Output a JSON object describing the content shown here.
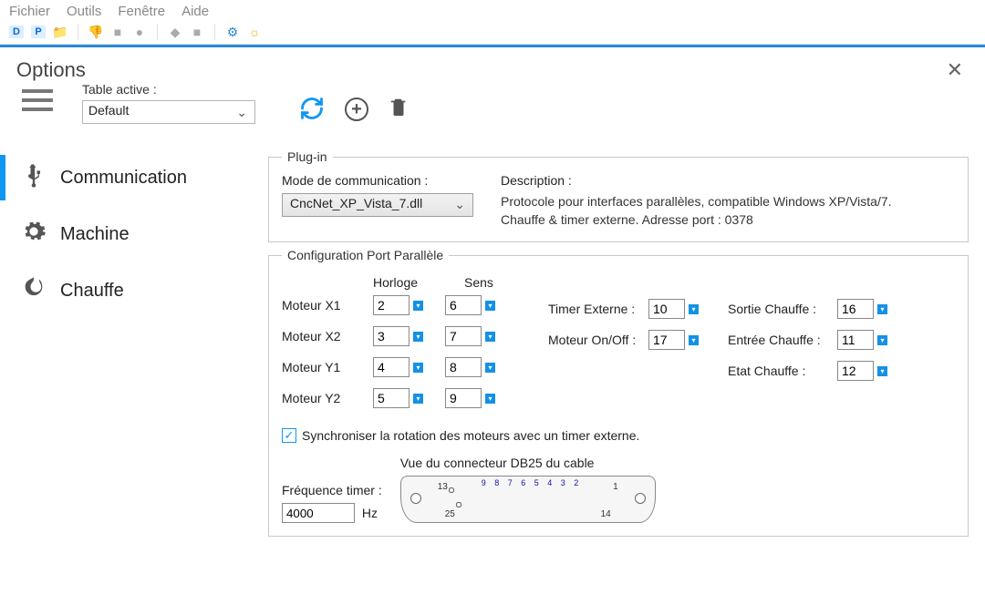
{
  "menu": {
    "file": "Fichier",
    "tools": "Outils",
    "window": "Fenêtre",
    "help": "Aide"
  },
  "options_title": "Options",
  "table": {
    "label": "Table active :",
    "value": "Default"
  },
  "sidebar": {
    "communication": "Communication",
    "machine": "Machine",
    "chauffe": "Chauffe"
  },
  "plugin": {
    "legend": "Plug-in",
    "mode_label": "Mode de communication :",
    "mode_value": "CncNet_XP_Vista_7.dll",
    "desc_label": "Description :",
    "desc_text": "Protocole pour interfaces parallèles, compatible Windows XP/Vista/7. Chauffe & timer externe. Adresse port : 0378"
  },
  "pp": {
    "legend": "Configuration Port Parallèle",
    "horloge": "Horloge",
    "sens": "Sens",
    "moteur_x1": "Moteur X1",
    "moteur_x2": "Moteur X2",
    "moteur_y1": "Moteur Y1",
    "moteur_y2": "Moteur Y2",
    "vx1h": "2",
    "vx1s": "6",
    "vx2h": "3",
    "vx2s": "7",
    "vy1h": "4",
    "vy1s": "8",
    "vy2h": "5",
    "vy2s": "9",
    "timer_ext": "Timer Externe :",
    "timer_ext_v": "10",
    "moteur_onoff": "Moteur On/Off :",
    "moteur_onoff_v": "17",
    "sortie_chauffe": "Sortie Chauffe :",
    "sortie_chauffe_v": "16",
    "entree_chauffe": "Entrée Chauffe :",
    "entree_chauffe_v": "11",
    "etat_chauffe": "Etat Chauffe :",
    "etat_chauffe_v": "12",
    "sync": "Synchroniser la rotation des moteurs avec un timer externe.",
    "freq_label": "Fréquence timer :",
    "freq_v": "4000",
    "hz": "Hz",
    "db25_label": "Vue du connecteur DB25 du cable",
    "db25_top": "9 8 7 6 5 4 3 2"
  }
}
